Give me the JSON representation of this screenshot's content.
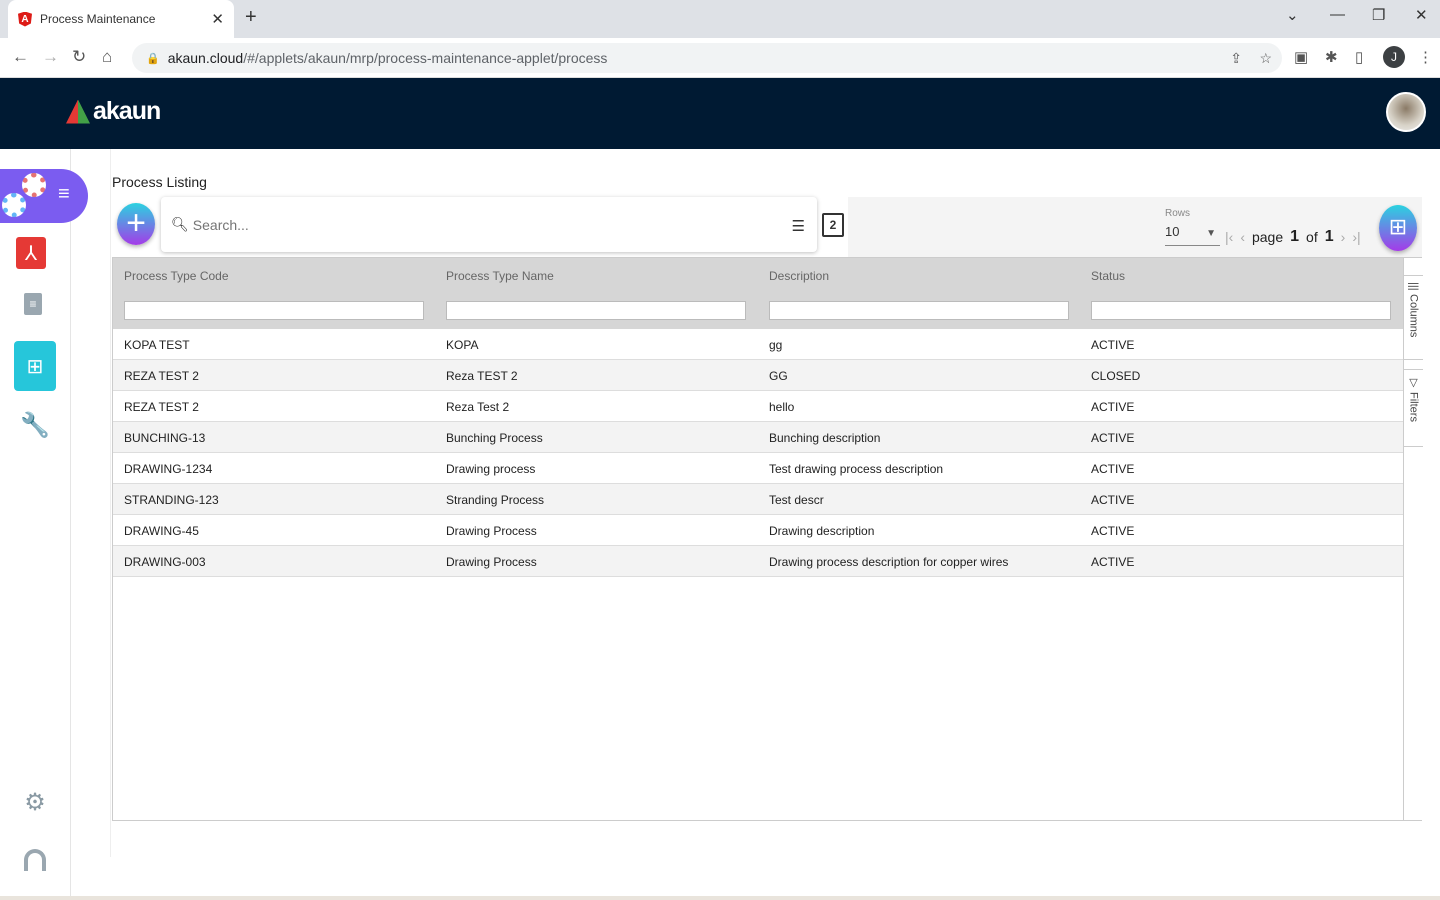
{
  "browser": {
    "tab_title": "Process Maintenance",
    "url_host": "akaun.cloud",
    "url_path": "/#/applets/akaun/mrp/process-maintenance-applet/process",
    "profile_initial": "J"
  },
  "app": {
    "logo_text": "akaun"
  },
  "page": {
    "title": "Process Listing",
    "search_placeholder": "Search...",
    "copy_badge": "2"
  },
  "pagination": {
    "rows_label": "Rows",
    "rows_value": "10",
    "page_label": "page",
    "page": "1",
    "of_label": "of",
    "total_pages": "1"
  },
  "table": {
    "columns": [
      "Process Type Code",
      "Process Type Name",
      "Description",
      "Status"
    ],
    "rows": [
      [
        "KOPA TEST",
        "KOPA",
        "gg",
        "ACTIVE"
      ],
      [
        "REZA TEST 2",
        "Reza TEST 2",
        "GG",
        "CLOSED"
      ],
      [
        "REZA TEST 2",
        "Reza Test 2",
        "hello",
        "ACTIVE"
      ],
      [
        "BUNCHING-13",
        "Bunching Process",
        "Bunching description",
        "ACTIVE"
      ],
      [
        "DRAWING-1234",
        "Drawing process",
        "Test drawing process description",
        "ACTIVE"
      ],
      [
        "STRANDING-123",
        "Stranding Process",
        "Test descr",
        "ACTIVE"
      ],
      [
        "DRAWING-45",
        "Drawing Process",
        "Drawing description",
        "ACTIVE"
      ],
      [
        "DRAWING-003",
        "Drawing Process",
        "Drawing process description for copper wires",
        "ACTIVE"
      ]
    ]
  },
  "side_panel": {
    "columns_label": "Columns",
    "filters_label": "Filters"
  }
}
